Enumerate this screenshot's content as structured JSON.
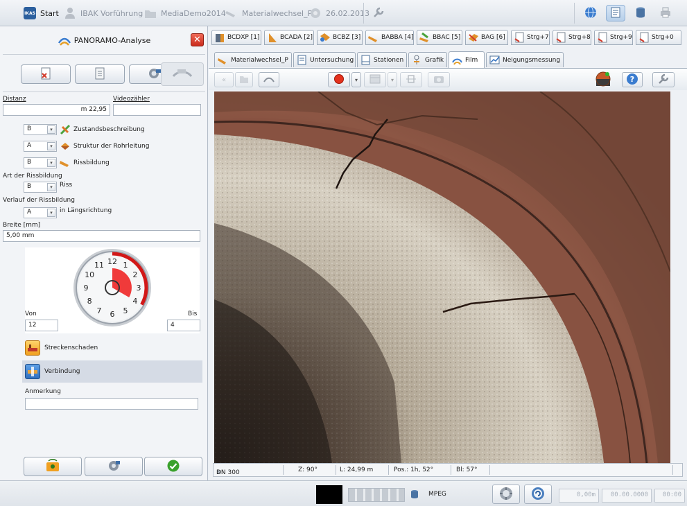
{
  "topbar": {
    "crumbs": [
      {
        "label": "Start",
        "icon": "ikas-logo-icon",
        "dim": false
      },
      {
        "label": "IBAK Vorführung",
        "icon": "person-icon",
        "dim": true
      },
      {
        "label": "MediaDemo2014",
        "icon": "folder-icon",
        "dim": true
      },
      {
        "label": "Materialwechsel_P",
        "icon": "pipe-icon",
        "dim": true
      },
      {
        "label": "26.02.2013",
        "icon": "survey-icon",
        "dim": true
      }
    ],
    "logo_text": "IKAS"
  },
  "left": {
    "title": "PANORAMO-Analyse",
    "close_label": "✕",
    "distance_label": "Distanz",
    "distance_value": "m 22,95",
    "counter_label": "Videozähler",
    "counter_value": "",
    "selects": [
      {
        "value": "B",
        "text": "Zustandsbeschreibung",
        "icon": "condition-icon"
      },
      {
        "value": "A",
        "text": "Struktur der Rohrleitung",
        "icon": "structure-icon"
      },
      {
        "value": "B",
        "text": "Rissbildung",
        "icon": "crack-pipe-icon"
      }
    ],
    "type_label": "Art der Rissbildung",
    "type_value": "B",
    "type_text": "Riss",
    "course_label": "Verlauf der Rissbildung",
    "course_value": "A",
    "course_text": "in Längsrichtung",
    "width_label": "Breite [mm]",
    "width_value": "5,00 mm",
    "from_label": "Von",
    "from_value": "12",
    "to_label": "Bis",
    "to_value": "4",
    "clock_numbers": [
      "12",
      "1",
      "2",
      "3",
      "4",
      "5",
      "6",
      "7",
      "8",
      "9",
      "10",
      "11"
    ],
    "row1_label": "Streckenschaden",
    "row2_label": "Verbindung",
    "note_label": "Anmerkung",
    "note_value": ""
  },
  "sessions": [
    {
      "label": "BCDXP [1]",
      "icon": "pipe-icon"
    },
    {
      "label": "BCADA [2]",
      "icon": "branch-icon"
    },
    {
      "label": "BCBZ [3]",
      "icon": "pipe-icon"
    },
    {
      "label": "BABBA [4]",
      "icon": "pipe-icon"
    },
    {
      "label": "BBAC [5]",
      "icon": "pipe-icon"
    },
    {
      "label": "BAG [6]",
      "icon": "pipe-icon"
    },
    {
      "label": "Strg+7",
      "icon": "document-icon"
    },
    {
      "label": "Strg+8",
      "icon": "document-icon"
    },
    {
      "label": "Strg+9",
      "icon": "document-icon"
    },
    {
      "label": "Strg+0",
      "icon": "document-icon"
    }
  ],
  "views": [
    {
      "label": "Materialwechsel_P",
      "icon": "pipe-icon"
    },
    {
      "label": "Untersuchung",
      "icon": "document-icon"
    },
    {
      "label": "Stationen",
      "icon": "stations-icon"
    },
    {
      "label": "Grafik",
      "icon": "graphic-icon"
    },
    {
      "label": "Film",
      "icon": "film-icon"
    },
    {
      "label": "Neigungsmessung",
      "icon": "incline-icon"
    }
  ],
  "active_view": "Film",
  "video_status": {
    "dn": "DN 300",
    "z": "Z: 90°",
    "l": "L: 24,99 m",
    "pos": "Pos.: 1h, 52°",
    "bl": "Bl: 57°"
  },
  "bottom": {
    "codec": "MPEG",
    "distance": "0,00m",
    "date": "00.00.0000",
    "time": "00:00"
  },
  "colors": {
    "accent_red": "#e23b2b",
    "highlight": "#d5dbe5",
    "pipe_wall": "#8b5442",
    "sediment": "#c9c2b4"
  }
}
